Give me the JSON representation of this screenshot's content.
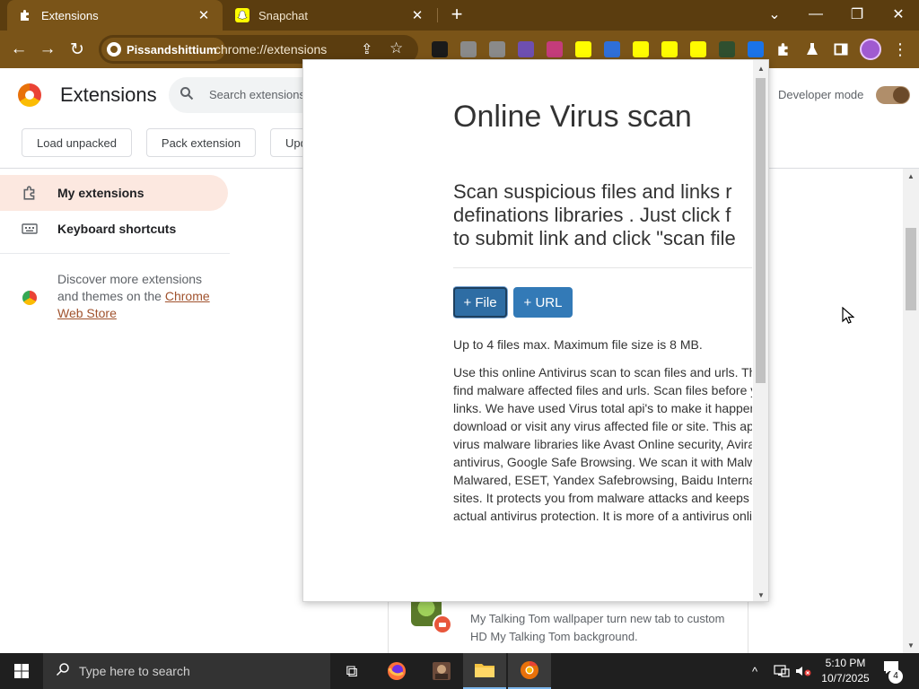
{
  "browser": {
    "tabs": [
      {
        "title": "Extensions",
        "icon": "puzzle-icon",
        "active": true
      },
      {
        "title": "Snapchat",
        "icon": "snapchat-icon",
        "active": false
      }
    ],
    "close_glyph": "✕",
    "new_tab_glyph": "+",
    "window_controls": {
      "minimize": "—",
      "maximize": "❐",
      "close": "✕",
      "dropdown": "⌄"
    },
    "nav": {
      "back": "←",
      "forward": "→",
      "reload": "↻"
    },
    "profile_chip": "Pissandshittium",
    "url": "chrome://extensions",
    "share_glyph": "⇪",
    "star_glyph": "☆",
    "menu_glyph": "⋮",
    "extension_icon_colors": [
      "#1a1a1a",
      "#8a8a8a",
      "#8a8a8a",
      "#6e4fb0",
      "#c43c7a",
      "#fffc00",
      "#2f6fd8",
      "#fffc00",
      "#fffc00",
      "#fffc00",
      "#2f4f2f",
      "#1a73e8"
    ],
    "theme_colors": {
      "frame": "#5b3d0f",
      "toolbar": "#7a5418",
      "accent": "#a0522d"
    }
  },
  "extensions_page": {
    "title": "Extensions",
    "search_placeholder": "Search extensions",
    "developer_mode_label": "Developer mode",
    "developer_mode_on": true,
    "buttons": {
      "load_unpacked": "Load unpacked",
      "pack_extension": "Pack extension",
      "update": "Upd"
    },
    "sidebar": {
      "items": [
        {
          "label": "My extensions",
          "icon": "puzzle-outline-icon"
        },
        {
          "label": "Keyboard shortcuts",
          "icon": "keyboard-icon"
        }
      ],
      "discover_text": "Discover more extensions and themes on the ",
      "webstore_link": "Chrome Web Store"
    },
    "card": {
      "description": "My Talking Tom wallpaper turn new tab to custom HD My Talking Tom background."
    }
  },
  "popup": {
    "title": "Online Virus scan",
    "lead_lines": [
      "Scan suspicious files and links r",
      "definations libraries . Just click f",
      "to submit link and click \"scan file"
    ],
    "file_button": "+ File",
    "url_button": "+ URL",
    "limit_text": "Up to 4 files max. Maximum file size is 8 MB.",
    "body_lines": [
      "Use this online Antivirus scan to scan files and urls. Th",
      "find malware affected files and urls. Scan files before y",
      "links. We have used Virus total api's to make it happen",
      "download or visit any virus affected file or site. This ap",
      "virus malware libraries like Avast Online security, Avira",
      "antivirus, Google Safe Browsing. We scan it with Malw",
      "Malwared, ESET, Yandex Safebrowsing, Baidu Interna",
      "sites. It protects you from malware attacks and keeps",
      "actual antivirus protection. It is more of a antivirus onli"
    ]
  },
  "taskbar": {
    "search_placeholder": "Type here to search",
    "clock_time": "5:10 PM",
    "clock_date": "10/7/2025",
    "notification_count": "4",
    "apps": [
      {
        "name": "task-view-icon",
        "glyph": "⧉"
      },
      {
        "name": "firefox-icon",
        "glyph": ""
      },
      {
        "name": "photo-app-icon",
        "glyph": ""
      },
      {
        "name": "file-explorer-icon",
        "glyph": ""
      },
      {
        "name": "chrome-icon",
        "glyph": ""
      }
    ],
    "tray": {
      "chevron": "^",
      "network": "⊟",
      "volume": "🔈"
    }
  }
}
